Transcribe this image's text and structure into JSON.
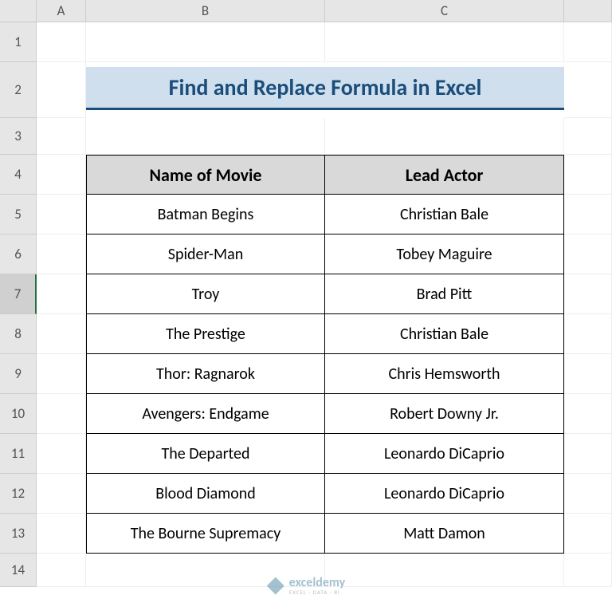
{
  "columns": [
    "A",
    "B",
    "C"
  ],
  "rows": [
    "1",
    "2",
    "3",
    "4",
    "5",
    "6",
    "7",
    "8",
    "9",
    "10",
    "11",
    "12",
    "13",
    "14"
  ],
  "selectedRow": "7",
  "title": "Find and Replace Formula in Excel",
  "tableHeaders": {
    "colB": "Name of Movie",
    "colC": "Lead Actor"
  },
  "tableData": [
    {
      "movie": "Batman Begins",
      "actor": "Christian Bale"
    },
    {
      "movie": "Spider-Man",
      "actor": "Tobey Maguire"
    },
    {
      "movie": "Troy",
      "actor": "Brad Pitt"
    },
    {
      "movie": "The Prestige",
      "actor": "Christian Bale"
    },
    {
      "movie": "Thor: Ragnarok",
      "actor": "Chris Hemsworth"
    },
    {
      "movie": "Avengers: Endgame",
      "actor": "Robert Downy Jr."
    },
    {
      "movie": "The Departed",
      "actor": "Leonardo DiCaprio"
    },
    {
      "movie": "Blood Diamond",
      "actor": "Leonardo DiCaprio"
    },
    {
      "movie": "The Bourne Supremacy",
      "actor": "Matt Damon"
    }
  ],
  "watermark": {
    "main": "exceldemy",
    "sub": "EXCEL · DATA · BI"
  }
}
